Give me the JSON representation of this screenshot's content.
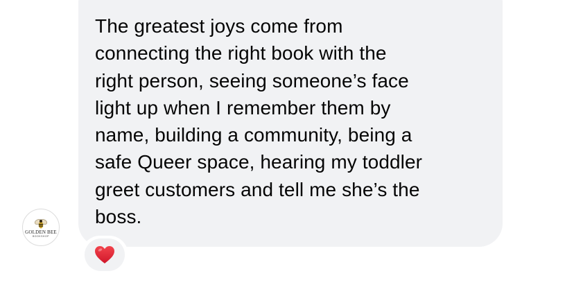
{
  "message": {
    "lines": [
      "The greatest joys come from",
      "connecting the right book with the",
      "right person, seeing someone’s face",
      "light up when I remember them by",
      "name, building a community, being a",
      "safe Queer space, hearing my toddler",
      "greet customers and tell me she’s the",
      "boss."
    ]
  },
  "avatar": {
    "brand_name": "GOLDEN BEE",
    "brand_sub": "BOOKSHOP",
    "icon": "bee-icon"
  },
  "reaction": {
    "icon": "red-heart-icon",
    "color": "#e0262f"
  },
  "colors": {
    "bubble": "#f1f2f4",
    "text": "#050505",
    "background": "#ffffff"
  }
}
